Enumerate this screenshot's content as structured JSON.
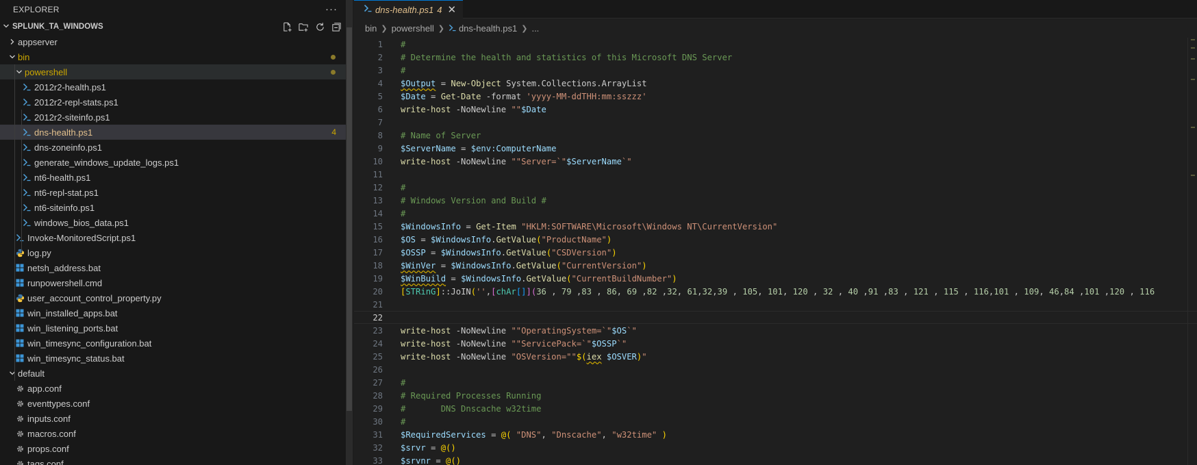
{
  "sidebar": {
    "title": "EXPLORER",
    "more": "···",
    "folder": "SPLUNK_TA_WINDOWS",
    "actions": [
      "new-file-icon",
      "new-folder-icon",
      "refresh-icon",
      "collapse-all-icon"
    ],
    "items": [
      {
        "label": "appserver",
        "kind": "folder",
        "depth": 0,
        "open": false
      },
      {
        "label": "bin",
        "kind": "folder",
        "depth": 0,
        "open": true,
        "modified": true
      },
      {
        "label": "powershell",
        "kind": "folder",
        "depth": 1,
        "open": true,
        "modified": true,
        "highlight": true
      },
      {
        "label": "2012r2-health.ps1",
        "kind": "ps1",
        "depth": 2
      },
      {
        "label": "2012r2-repl-stats.ps1",
        "kind": "ps1",
        "depth": 2
      },
      {
        "label": "2012r2-siteinfo.ps1",
        "kind": "ps1",
        "depth": 2
      },
      {
        "label": "dns-health.ps1",
        "kind": "ps1",
        "depth": 2,
        "selected": true,
        "problems": "4"
      },
      {
        "label": "dns-zoneinfo.ps1",
        "kind": "ps1",
        "depth": 2
      },
      {
        "label": "generate_windows_update_logs.ps1",
        "kind": "ps1",
        "depth": 2
      },
      {
        "label": "nt6-health.ps1",
        "kind": "ps1",
        "depth": 2
      },
      {
        "label": "nt6-repl-stat.ps1",
        "kind": "ps1",
        "depth": 2
      },
      {
        "label": "nt6-siteinfo.ps1",
        "kind": "ps1",
        "depth": 2
      },
      {
        "label": "windows_bios_data.ps1",
        "kind": "ps1",
        "depth": 2
      },
      {
        "label": "Invoke-MonitoredScript.ps1",
        "kind": "ps1",
        "depth": 1
      },
      {
        "label": "log.py",
        "kind": "py",
        "depth": 1
      },
      {
        "label": "netsh_address.bat",
        "kind": "bat",
        "depth": 1
      },
      {
        "label": "runpowershell.cmd",
        "kind": "bat",
        "depth": 1
      },
      {
        "label": "user_account_control_property.py",
        "kind": "py",
        "depth": 1
      },
      {
        "label": "win_installed_apps.bat",
        "kind": "bat",
        "depth": 1
      },
      {
        "label": "win_listening_ports.bat",
        "kind": "bat",
        "depth": 1
      },
      {
        "label": "win_timesync_configuration.bat",
        "kind": "bat",
        "depth": 1
      },
      {
        "label": "win_timesync_status.bat",
        "kind": "bat",
        "depth": 1
      },
      {
        "label": "default",
        "kind": "folder",
        "depth": 0,
        "open": true
      },
      {
        "label": "app.conf",
        "kind": "conf",
        "depth": 1
      },
      {
        "label": "eventtypes.conf",
        "kind": "conf",
        "depth": 1
      },
      {
        "label": "inputs.conf",
        "kind": "conf",
        "depth": 1
      },
      {
        "label": "macros.conf",
        "kind": "conf",
        "depth": 1
      },
      {
        "label": "props.conf",
        "kind": "conf",
        "depth": 1
      },
      {
        "label": "tags.conf",
        "kind": "conf",
        "depth": 1
      }
    ]
  },
  "editor": {
    "tab": {
      "label": "dns-health.ps1",
      "problems": "4"
    },
    "breadcrumb": [
      "bin",
      "powershell",
      "dns-health.ps1",
      "..."
    ],
    "current_line": 22,
    "lines": [
      [
        [
          "c",
          "#"
        ]
      ],
      [
        [
          "c",
          "# Determine the health and statistics of this Microsoft DNS Server"
        ]
      ],
      [
        [
          "c",
          "#"
        ]
      ],
      [
        [
          "vq",
          "$Output"
        ],
        [
          "",
          " = "
        ],
        [
          "w",
          "New-Object"
        ],
        [
          "",
          " System.Collections.ArrayList"
        ]
      ],
      [
        [
          "v",
          "$Date"
        ],
        [
          "",
          " = "
        ],
        [
          "w",
          "Get-Date"
        ],
        [
          "",
          " -format "
        ],
        [
          "s",
          "'yyyy-MM-ddTHH:mm:sszzz'"
        ]
      ],
      [
        [
          "w",
          "write-host"
        ],
        [
          "",
          " -NoNewline "
        ],
        [
          "s",
          "\"\""
        ],
        [
          "v",
          "$Date"
        ]
      ],
      [],
      [
        [
          "c",
          "# Name of Server"
        ]
      ],
      [
        [
          "v",
          "$ServerName"
        ],
        [
          "",
          " = "
        ],
        [
          "v",
          "$env:ComputerName"
        ]
      ],
      [
        [
          "w",
          "write-host"
        ],
        [
          "",
          " -NoNewline "
        ],
        [
          "s",
          "\"\"Server=`\""
        ],
        [
          "v",
          "$ServerName"
        ],
        [
          "s",
          "`\""
        ]
      ],
      [],
      [
        [
          "c",
          "#"
        ]
      ],
      [
        [
          "c",
          "# Windows Version and Build #"
        ]
      ],
      [
        [
          "c",
          "#"
        ]
      ],
      [
        [
          "v",
          "$WindowsInfo"
        ],
        [
          "",
          " = "
        ],
        [
          "w",
          "Get-Item"
        ],
        [
          "",
          " "
        ],
        [
          "s",
          "\"HKLM:SOFTWARE\\Microsoft\\Windows NT\\CurrentVersion\""
        ]
      ],
      [
        [
          "v",
          "$OS"
        ],
        [
          "",
          " = "
        ],
        [
          "v",
          "$WindowsInfo"
        ],
        [
          "",
          "."
        ],
        [
          "w",
          "GetValue"
        ],
        [
          "b1",
          "("
        ],
        [
          "s",
          "\"ProductName\""
        ],
        [
          "b1",
          ")"
        ]
      ],
      [
        [
          "v",
          "$OSSP"
        ],
        [
          "",
          " = "
        ],
        [
          "v",
          "$WindowsInfo"
        ],
        [
          "",
          "."
        ],
        [
          "w",
          "GetValue"
        ],
        [
          "b1",
          "("
        ],
        [
          "s",
          "\"CSDVersion\""
        ],
        [
          "b1",
          ")"
        ]
      ],
      [
        [
          "vq",
          "$WinVer"
        ],
        [
          "",
          " = "
        ],
        [
          "v",
          "$WindowsInfo"
        ],
        [
          "",
          "."
        ],
        [
          "w",
          "GetValue"
        ],
        [
          "b1",
          "("
        ],
        [
          "s",
          "\"CurrentVersion\""
        ],
        [
          "b1",
          ")"
        ]
      ],
      [
        [
          "vq",
          "$WinBuild"
        ],
        [
          "",
          " = "
        ],
        [
          "v",
          "$WindowsInfo"
        ],
        [
          "",
          "."
        ],
        [
          "w",
          "GetValue"
        ],
        [
          "b1",
          "("
        ],
        [
          "s",
          "\"CurrentBuildNumber\""
        ],
        [
          "b1",
          ")"
        ]
      ],
      [
        [
          "b1",
          "["
        ],
        [
          "t",
          "STRinG"
        ],
        [
          "b1",
          "]"
        ],
        [
          "",
          "::JoIN"
        ],
        [
          "b1",
          "("
        ],
        [
          "s",
          "''"
        ],
        [
          "",
          ","
        ],
        [
          "b2",
          "["
        ],
        [
          "t",
          "chAr"
        ],
        [
          "b3",
          "[]"
        ],
        [
          "b2",
          "]"
        ],
        [
          "b2",
          "("
        ],
        [
          "n",
          "36"
        ],
        [
          "",
          " , "
        ],
        [
          "n",
          "79"
        ],
        [
          "",
          " ,"
        ],
        [
          "n",
          "83"
        ],
        [
          "",
          " , "
        ],
        [
          "n",
          "86"
        ],
        [
          "",
          ", "
        ],
        [
          "n",
          "69"
        ],
        [
          "",
          " ,"
        ],
        [
          "n",
          "82"
        ],
        [
          "",
          " ,"
        ],
        [
          "n",
          "32"
        ],
        [
          "",
          ", "
        ],
        [
          "n",
          "61"
        ],
        [
          "",
          ","
        ],
        [
          "n",
          "32"
        ],
        [
          "",
          ","
        ],
        [
          "n",
          "39"
        ],
        [
          "",
          " , "
        ],
        [
          "n",
          "105"
        ],
        [
          "",
          ", "
        ],
        [
          "n",
          "101"
        ],
        [
          "",
          ", "
        ],
        [
          "n",
          "120"
        ],
        [
          "",
          " , "
        ],
        [
          "n",
          "32"
        ],
        [
          "",
          " , "
        ],
        [
          "n",
          "40"
        ],
        [
          "",
          " ,"
        ],
        [
          "n",
          "91"
        ],
        [
          "",
          " ,"
        ],
        [
          "n",
          "83"
        ],
        [
          "",
          " , "
        ],
        [
          "n",
          "121"
        ],
        [
          "",
          " , "
        ],
        [
          "n",
          "115"
        ],
        [
          "",
          " , "
        ],
        [
          "n",
          "116"
        ],
        [
          "",
          ","
        ],
        [
          "n",
          "101"
        ],
        [
          "",
          " , "
        ],
        [
          "n",
          "109"
        ],
        [
          "",
          ", "
        ],
        [
          "n",
          "46"
        ],
        [
          "",
          ","
        ],
        [
          "n",
          "84"
        ],
        [
          "",
          " ,"
        ],
        [
          "n",
          "101"
        ],
        [
          "",
          " ,"
        ],
        [
          "n",
          "120"
        ],
        [
          "",
          " , "
        ],
        [
          "n",
          "116"
        ]
      ],
      [],
      [],
      [
        [
          "w",
          "write-host"
        ],
        [
          "",
          " -NoNewline "
        ],
        [
          "s",
          "\"\"OperatingSystem=`\""
        ],
        [
          "v",
          "$OS"
        ],
        [
          "s",
          "`\""
        ]
      ],
      [
        [
          "w",
          "write-host"
        ],
        [
          "",
          " -NoNewline "
        ],
        [
          "s",
          "\"\"ServicePack=`\""
        ],
        [
          "v",
          "$OSSP"
        ],
        [
          "s",
          "`\""
        ]
      ],
      [
        [
          "w",
          "write-host"
        ],
        [
          "",
          " -NoNewline "
        ],
        [
          "s",
          "\"OSVersion=\"\""
        ],
        [
          "b1",
          "$("
        ],
        [
          "wq",
          "iex"
        ],
        [
          "",
          " "
        ],
        [
          "v",
          "$OSVER"
        ],
        [
          "b1",
          ")"
        ],
        [
          "s",
          "\""
        ]
      ],
      [],
      [
        [
          "c",
          "#"
        ]
      ],
      [
        [
          "c",
          "# Required Processes Running"
        ]
      ],
      [
        [
          "c",
          "#       DNS Dnscache w32time"
        ]
      ],
      [
        [
          "c",
          "#"
        ]
      ],
      [
        [
          "v",
          "$RequiredServices"
        ],
        [
          "",
          " = "
        ],
        [
          "b1",
          "@("
        ],
        [
          "",
          " "
        ],
        [
          "s",
          "\"DNS\""
        ],
        [
          "",
          ", "
        ],
        [
          "s",
          "\"Dnscache\""
        ],
        [
          "",
          ", "
        ],
        [
          "s",
          "\"w32time\""
        ],
        [
          "",
          " "
        ],
        [
          "b1",
          ")"
        ]
      ],
      [
        [
          "v",
          "$srvr"
        ],
        [
          "",
          " = "
        ],
        [
          "b1",
          "@()"
        ]
      ],
      [
        [
          "v",
          "$srvnr"
        ],
        [
          "",
          " = "
        ],
        [
          "b1",
          "@()"
        ]
      ]
    ]
  },
  "colors": {
    "modified": "#cca700",
    "accent": "#0078d4",
    "selection": "#37373d"
  }
}
